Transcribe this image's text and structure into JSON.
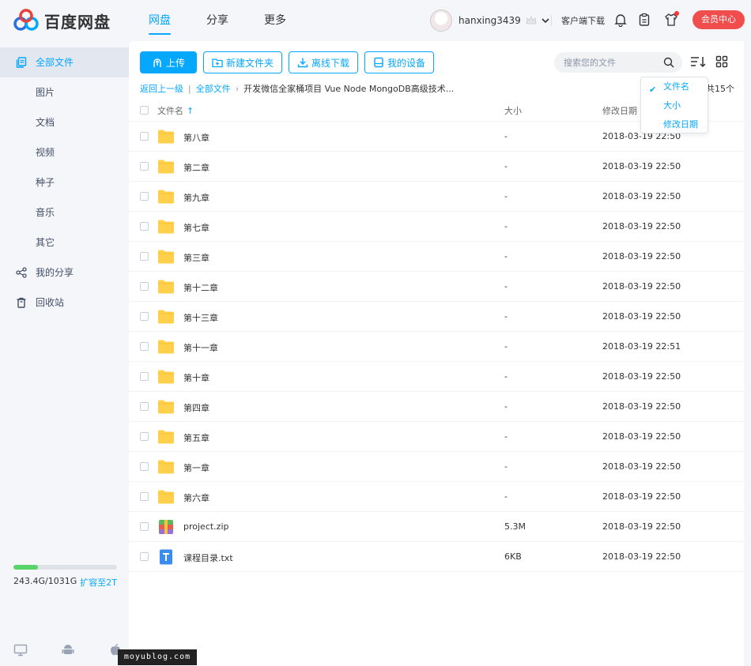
{
  "logo": {
    "text": "百度网盘"
  },
  "nav": {
    "items": [
      "网盘",
      "分享",
      "更多"
    ],
    "active": 0
  },
  "user": {
    "name": "hanxing3439",
    "client_download": "客户端下载",
    "vip_button": "会员中心"
  },
  "sidebar": {
    "items": [
      {
        "label": "全部文件",
        "icon": "files-icon",
        "active": true
      },
      {
        "label": "图片"
      },
      {
        "label": "文档"
      },
      {
        "label": "视频"
      },
      {
        "label": "种子"
      },
      {
        "label": "音乐"
      },
      {
        "label": "其它"
      },
      {
        "label": "我的分享",
        "icon": "share-icon"
      },
      {
        "label": "回收站",
        "icon": "trash-icon"
      }
    ],
    "quota": {
      "used": "243.4G/1031G",
      "expand": "扩容至2T",
      "percent": 23.6
    }
  },
  "toolbar": {
    "upload": "上传",
    "new_folder": "新建文件夹",
    "offline_download": "离线下载",
    "my_devices": "我的设备"
  },
  "search": {
    "placeholder": "搜索您的文件"
  },
  "breadcrumb": {
    "back": "返回上一级",
    "root": "全部文件",
    "current": "开发微信全家桶项目 Vue Node MongoDB高级技术..."
  },
  "count_text": "共15个",
  "table": {
    "headers": {
      "name": "文件名",
      "size": "大小",
      "date": "修改日期"
    },
    "rows": [
      {
        "name": "第八章",
        "size": "-",
        "date": "2018-03-19 22:50",
        "type": "folder"
      },
      {
        "name": "第二章",
        "size": "-",
        "date": "2018-03-19 22:50",
        "type": "folder"
      },
      {
        "name": "第九章",
        "size": "-",
        "date": "2018-03-19 22:50",
        "type": "folder"
      },
      {
        "name": "第七章",
        "size": "-",
        "date": "2018-03-19 22:50",
        "type": "folder"
      },
      {
        "name": "第三章",
        "size": "-",
        "date": "2018-03-19 22:50",
        "type": "folder"
      },
      {
        "name": "第十二章",
        "size": "-",
        "date": "2018-03-19 22:50",
        "type": "folder"
      },
      {
        "name": "第十三章",
        "size": "-",
        "date": "2018-03-19 22:50",
        "type": "folder"
      },
      {
        "name": "第十一章",
        "size": "-",
        "date": "2018-03-19 22:51",
        "type": "folder"
      },
      {
        "name": "第十章",
        "size": "-",
        "date": "2018-03-19 22:50",
        "type": "folder"
      },
      {
        "name": "第四章",
        "size": "-",
        "date": "2018-03-19 22:50",
        "type": "folder"
      },
      {
        "name": "第五章",
        "size": "-",
        "date": "2018-03-19 22:50",
        "type": "folder"
      },
      {
        "name": "第一章",
        "size": "-",
        "date": "2018-03-19 22:50",
        "type": "folder"
      },
      {
        "name": "第六章",
        "size": "-",
        "date": "2018-03-19 22:50",
        "type": "folder"
      },
      {
        "name": "project.zip",
        "size": "5.3M",
        "date": "2018-03-19 22:50",
        "type": "zip"
      },
      {
        "name": "课程目录.txt",
        "size": "6KB",
        "date": "2018-03-19 22:50",
        "type": "txt"
      }
    ]
  },
  "sort_menu": {
    "items": [
      "文件名",
      "大小",
      "修改日期"
    ],
    "selected": 0
  },
  "watermark": "moyublog.com",
  "colors": {
    "accent": "#06a7ff",
    "vip": "#f04d4d",
    "folder": "#ffd04b",
    "quota_fill": "#58d468"
  }
}
